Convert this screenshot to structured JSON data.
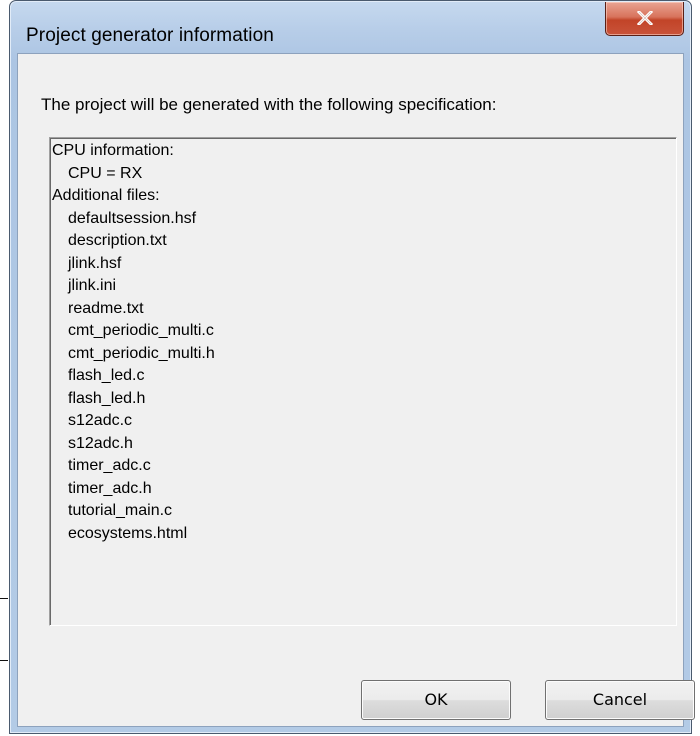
{
  "window": {
    "title": "Project generator information",
    "close_symbol": "✕",
    "close_icon": "close-icon"
  },
  "dialog": {
    "heading": "The project will be generated with the following specification:",
    "spec_lines": [
      {
        "text": "CPU information:",
        "indent": false
      },
      {
        "text": "CPU = RX",
        "indent": true
      },
      {
        "text": "Additional files:",
        "indent": false
      },
      {
        "text": "defaultsession.hsf",
        "indent": true
      },
      {
        "text": "description.txt",
        "indent": true
      },
      {
        "text": "jlink.hsf",
        "indent": true
      },
      {
        "text": "jlink.ini",
        "indent": true
      },
      {
        "text": "readme.txt",
        "indent": true
      },
      {
        "text": "cmt_periodic_multi.c",
        "indent": true
      },
      {
        "text": "cmt_periodic_multi.h",
        "indent": true
      },
      {
        "text": "flash_led.c",
        "indent": true
      },
      {
        "text": "flash_led.h",
        "indent": true
      },
      {
        "text": "s12adc.c",
        "indent": true
      },
      {
        "text": "s12adc.h",
        "indent": true
      },
      {
        "text": "timer_adc.c",
        "indent": true
      },
      {
        "text": "timer_adc.h",
        "indent": true
      },
      {
        "text": "tutorial_main.c",
        "indent": true
      },
      {
        "text": "ecosystems.html",
        "indent": true
      }
    ]
  },
  "buttons": {
    "ok_label": "OK",
    "cancel_label": "Cancel"
  },
  "colors": {
    "close_button": "#c9533a",
    "title_bar": "#b7cde8",
    "client_background": "#f0f0f0"
  }
}
